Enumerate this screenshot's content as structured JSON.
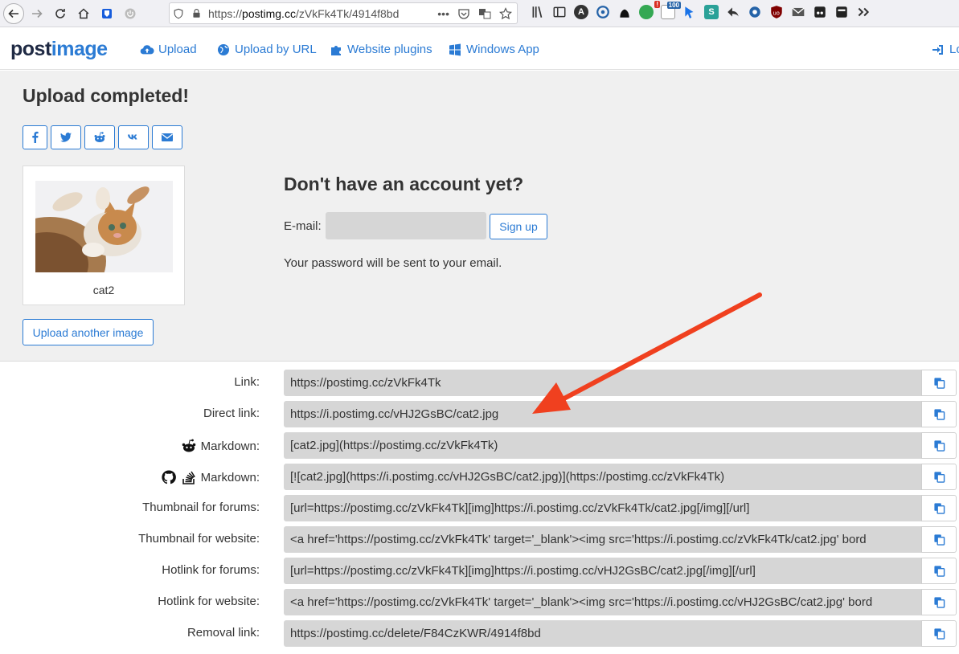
{
  "browser": {
    "url_prefix": "https://",
    "url_host": "postimg.cc",
    "url_path": "/zVkFk4Tk/4914f8bd",
    "more": "•••",
    "extension_badge_count": "100"
  },
  "header": {
    "logo_part1": "post",
    "logo_part2": "image",
    "nav": {
      "upload": "Upload",
      "upload_by_url": "Upload by URL",
      "website_plugins": "Website plugins",
      "windows_app": "Windows App",
      "login": "Lo"
    }
  },
  "upload": {
    "title": "Upload completed!",
    "thumbnail_caption": "cat2",
    "upload_another": "Upload another image"
  },
  "account": {
    "title": "Don't have an account yet?",
    "email_label": "E-mail:",
    "email_value": "",
    "signup": "Sign up",
    "password_note": "Your password will be sent to your email."
  },
  "links": [
    {
      "label": "Link:",
      "value": "https://postimg.cc/zVkFk4Tk"
    },
    {
      "label": "Direct link:",
      "value": "https://i.postimg.cc/vHJ2GsBC/cat2.jpg"
    },
    {
      "label": "Markdown:",
      "value": "[cat2.jpg](https://postimg.cc/zVkFk4Tk)"
    },
    {
      "label": "Markdown:",
      "value": "[![cat2.jpg](https://i.postimg.cc/vHJ2GsBC/cat2.jpg)](https://postimg.cc/zVkFk4Tk)"
    },
    {
      "label": "Thumbnail for forums:",
      "value": "[url=https://postimg.cc/zVkFk4Tk][img]https://i.postimg.cc/zVkFk4Tk/cat2.jpg[/img][/url]"
    },
    {
      "label": "Thumbnail for website:",
      "value": "<a href='https://postimg.cc/zVkFk4Tk' target='_blank'><img src='https://i.postimg.cc/zVkFk4Tk/cat2.jpg' bord"
    },
    {
      "label": "Hotlink for forums:",
      "value": "[url=https://postimg.cc/zVkFk4Tk][img]https://i.postimg.cc/vHJ2GsBC/cat2.jpg[/img][/url]"
    },
    {
      "label": "Hotlink for website:",
      "value": "<a href='https://postimg.cc/zVkFk4Tk' target='_blank'><img src='https://i.postimg.cc/vHJ2GsBC/cat2.jpg' bord"
    },
    {
      "label": "Removal link:",
      "value": "https://postimg.cc/delete/F84CzKWR/4914f8bd"
    }
  ],
  "colors": {
    "accent": "#2b7bd4",
    "annotation_arrow": "#f0401f",
    "field_bg": "#d6d6d6"
  },
  "icons": {
    "share": [
      "facebook-icon",
      "twitter-icon",
      "reddit-icon",
      "vk-icon",
      "email-icon"
    ],
    "copy": "copy-icon"
  }
}
